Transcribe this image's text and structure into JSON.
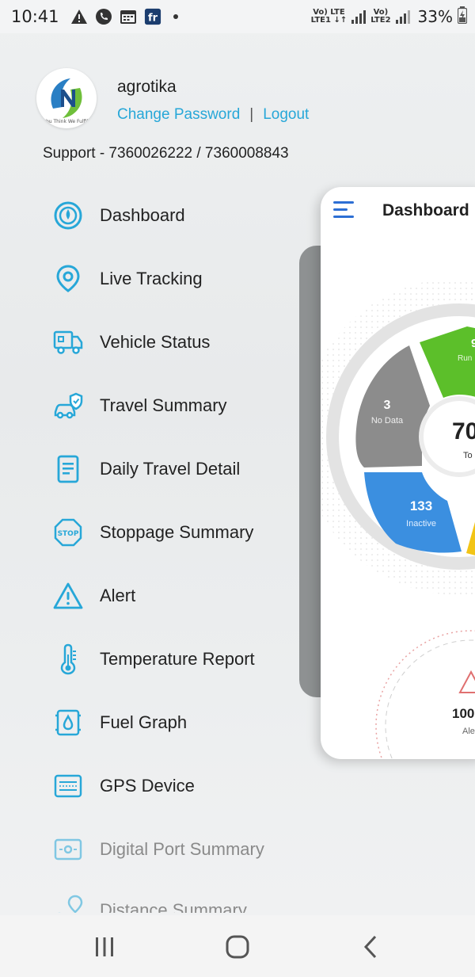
{
  "status_bar": {
    "time": "10:41",
    "lte1": "Vo) LTE\nLTE1",
    "lte2": "Vo)\nLTE2",
    "battery": "33%"
  },
  "profile": {
    "username": "agrotika",
    "change_password": "Change Password",
    "separator": "|",
    "logout": "Logout",
    "logo_tagline": "You Think We Fulfill",
    "logo_letter": "N",
    "support": "Support - 7360026222 / 7360008843"
  },
  "menu": {
    "items": [
      {
        "label": "Dashboard",
        "icon": "dashboard-icon"
      },
      {
        "label": "Live Tracking",
        "icon": "location-pin-icon"
      },
      {
        "label": "Vehicle Status",
        "icon": "truck-icon"
      },
      {
        "label": "Travel Summary",
        "icon": "car-shield-icon"
      },
      {
        "label": "Daily Travel Detail",
        "icon": "document-icon"
      },
      {
        "label": "Stoppage Summary",
        "icon": "stop-sign-icon"
      },
      {
        "label": "Alert",
        "icon": "warning-icon"
      },
      {
        "label": "Temperature Report",
        "icon": "thermometer-icon"
      },
      {
        "label": "Fuel Graph",
        "icon": "fuel-icon"
      },
      {
        "label": "GPS Device",
        "icon": "gps-device-icon"
      },
      {
        "label": "Digital Port Summary",
        "icon": "digital-port-icon"
      },
      {
        "label": "Distance Summary",
        "icon": "distance-icon"
      }
    ]
  },
  "preview": {
    "title": "Dashboard",
    "gauge": {
      "running_value": "9",
      "running_label": "Run",
      "nodata_value": "3",
      "nodata_label": "No Data",
      "total_value": "70",
      "total_label": "To",
      "inactive_value": "133",
      "inactive_label": "Inactive"
    },
    "alert_value": "100",
    "alert_label": "Ale"
  },
  "colors": {
    "accent": "#27a7d8",
    "running": "#5cbf2a",
    "nodata": "#8c8c8c",
    "inactive": "#3b8fe0",
    "idle": "#f2c416"
  }
}
